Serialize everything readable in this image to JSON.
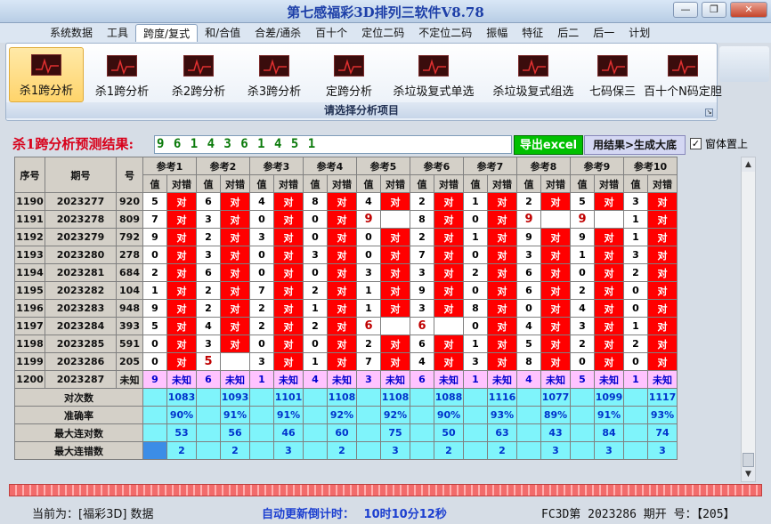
{
  "window": {
    "title": "第七感福彩3D排列三软件V8.78",
    "buttons": [
      "—",
      "❐",
      "✕"
    ]
  },
  "menu": {
    "tabs": [
      "系统数据",
      "工具",
      "跨度/复式",
      "和/合值",
      "合差/通杀",
      "百十个",
      "定位二码",
      "不定位二码",
      "振幅",
      "特征",
      "后二",
      "后一",
      "计划"
    ],
    "active_index": 2
  },
  "ribbon": {
    "buttons": [
      "杀1跨分析",
      "杀1跨分析",
      "杀2跨分析",
      "杀3跨分析",
      "定跨分析",
      "杀垃圾复式单选",
      "杀垃圾复式组选",
      "七码保三",
      "百十个N码定胆"
    ],
    "selected_index": 0,
    "caption": "请选择分析项目",
    "icon": "trend-chart-icon"
  },
  "result": {
    "label": "杀1跨分析预测结果:",
    "value": "9 6 1 4 3 6 1 4 5 1",
    "excel_button": "导出excel",
    "generate_button": "用结果>生成大底",
    "topmost_label": "窗体置上",
    "topmost_checked": true
  },
  "table": {
    "headers": {
      "seq": "序号",
      "period": "期号",
      "number": "号",
      "value": "值",
      "check": "对错"
    },
    "refs": [
      "参考1",
      "参考2",
      "参考3",
      "参考4",
      "参考5",
      "参考6",
      "参考7",
      "参考8",
      "参考9",
      "参考10"
    ],
    "rows": [
      {
        "seq": "1190",
        "period": "2023277",
        "num": "920",
        "cells": [
          [
            "5",
            "对"
          ],
          [
            "6",
            "对"
          ],
          [
            "4",
            "对"
          ],
          [
            "8",
            "对"
          ],
          [
            "4",
            "对"
          ],
          [
            "2",
            "对"
          ],
          [
            "1",
            "对"
          ],
          [
            "2",
            "对"
          ],
          [
            "5",
            "对"
          ],
          [
            "3",
            "对"
          ]
        ],
        "hl": []
      },
      {
        "seq": "1191",
        "period": "2023278",
        "num": "809",
        "cells": [
          [
            "7",
            "对"
          ],
          [
            "3",
            "对"
          ],
          [
            "0",
            "对"
          ],
          [
            "0",
            "对"
          ],
          [
            "9",
            ""
          ],
          [
            "8",
            "对"
          ],
          [
            "0",
            "对"
          ],
          [
            "9",
            ""
          ],
          [
            "9",
            ""
          ],
          [
            "1",
            "对"
          ]
        ],
        "hl": [
          4,
          7,
          8
        ]
      },
      {
        "seq": "1192",
        "period": "2023279",
        "num": "792",
        "cells": [
          [
            "9",
            "对"
          ],
          [
            "2",
            "对"
          ],
          [
            "3",
            "对"
          ],
          [
            "0",
            "对"
          ],
          [
            "0",
            "对"
          ],
          [
            "2",
            "对"
          ],
          [
            "1",
            "对"
          ],
          [
            "9",
            "对"
          ],
          [
            "9",
            "对"
          ],
          [
            "1",
            "对"
          ]
        ],
        "hl": []
      },
      {
        "seq": "1193",
        "period": "2023280",
        "num": "278",
        "cells": [
          [
            "0",
            "对"
          ],
          [
            "3",
            "对"
          ],
          [
            "0",
            "对"
          ],
          [
            "3",
            "对"
          ],
          [
            "0",
            "对"
          ],
          [
            "7",
            "对"
          ],
          [
            "0",
            "对"
          ],
          [
            "3",
            "对"
          ],
          [
            "1",
            "对"
          ],
          [
            "3",
            "对"
          ]
        ],
        "hl": []
      },
      {
        "seq": "1194",
        "period": "2023281",
        "num": "684",
        "cells": [
          [
            "2",
            "对"
          ],
          [
            "6",
            "对"
          ],
          [
            "0",
            "对"
          ],
          [
            "0",
            "对"
          ],
          [
            "3",
            "对"
          ],
          [
            "3",
            "对"
          ],
          [
            "2",
            "对"
          ],
          [
            "6",
            "对"
          ],
          [
            "0",
            "对"
          ],
          [
            "2",
            "对"
          ]
        ],
        "hl": []
      },
      {
        "seq": "1195",
        "period": "2023282",
        "num": "104",
        "cells": [
          [
            "1",
            "对"
          ],
          [
            "2",
            "对"
          ],
          [
            "7",
            "对"
          ],
          [
            "2",
            "对"
          ],
          [
            "1",
            "对"
          ],
          [
            "9",
            "对"
          ],
          [
            "0",
            "对"
          ],
          [
            "6",
            "对"
          ],
          [
            "2",
            "对"
          ],
          [
            "0",
            "对"
          ]
        ],
        "hl": []
      },
      {
        "seq": "1196",
        "period": "2023283",
        "num": "948",
        "cells": [
          [
            "9",
            "对"
          ],
          [
            "2",
            "对"
          ],
          [
            "2",
            "对"
          ],
          [
            "1",
            "对"
          ],
          [
            "1",
            "对"
          ],
          [
            "3",
            "对"
          ],
          [
            "8",
            "对"
          ],
          [
            "0",
            "对"
          ],
          [
            "4",
            "对"
          ],
          [
            "0",
            "对"
          ]
        ],
        "hl": []
      },
      {
        "seq": "1197",
        "period": "2023284",
        "num": "393",
        "cells": [
          [
            "5",
            "对"
          ],
          [
            "4",
            "对"
          ],
          [
            "2",
            "对"
          ],
          [
            "2",
            "对"
          ],
          [
            "6",
            ""
          ],
          [
            "6",
            ""
          ],
          [
            "0",
            "对"
          ],
          [
            "4",
            "对"
          ],
          [
            "3",
            "对"
          ],
          [
            "1",
            "对"
          ]
        ],
        "hl": [
          4,
          5
        ]
      },
      {
        "seq": "1198",
        "period": "2023285",
        "num": "591",
        "cells": [
          [
            "0",
            "对"
          ],
          [
            "3",
            "对"
          ],
          [
            "0",
            "对"
          ],
          [
            "0",
            "对"
          ],
          [
            "2",
            "对"
          ],
          [
            "6",
            "对"
          ],
          [
            "1",
            "对"
          ],
          [
            "5",
            "对"
          ],
          [
            "2",
            "对"
          ],
          [
            "2",
            "对"
          ]
        ],
        "hl": []
      },
      {
        "seq": "1199",
        "period": "2023286",
        "num": "205",
        "cells": [
          [
            "0",
            "对"
          ],
          [
            "5",
            ""
          ],
          [
            "3",
            "对"
          ],
          [
            "1",
            "对"
          ],
          [
            "7",
            "对"
          ],
          [
            "4",
            "对"
          ],
          [
            "3",
            "对"
          ],
          [
            "8",
            "对"
          ],
          [
            "0",
            "对"
          ],
          [
            "0",
            "对"
          ]
        ],
        "hl": [
          1
        ]
      },
      {
        "seq": "1200",
        "period": "2023287",
        "num": "未知",
        "cells": [
          [
            "9",
            "未知"
          ],
          [
            "6",
            "未知"
          ],
          [
            "1",
            "未知"
          ],
          [
            "4",
            "未知"
          ],
          [
            "3",
            "未知"
          ],
          [
            "6",
            "未知"
          ],
          [
            "1",
            "未知"
          ],
          [
            "4",
            "未知"
          ],
          [
            "5",
            "未知"
          ],
          [
            "1",
            "未知"
          ]
        ],
        "hl": [],
        "pending": true
      }
    ],
    "stats": [
      {
        "label": "对次数",
        "values": [
          "1083",
          "1093",
          "1101",
          "1108",
          "1108",
          "1088",
          "1116",
          "1077",
          "1099",
          "1117"
        ]
      },
      {
        "label": "准确率",
        "values": [
          "90%",
          "91%",
          "91%",
          "92%",
          "92%",
          "90%",
          "93%",
          "89%",
          "91%",
          "93%"
        ]
      },
      {
        "label": "最大连对数",
        "values": [
          "53",
          "56",
          "46",
          "60",
          "75",
          "50",
          "63",
          "43",
          "84",
          "74"
        ]
      },
      {
        "label": "最大连错数",
        "values": [
          "2",
          "2",
          "3",
          "2",
          "3",
          "2",
          "2",
          "3",
          "3",
          "3"
        ]
      }
    ]
  },
  "status": {
    "current": "当前为：[福彩3D] 数据",
    "countdown_label": "自动更新倒计时：",
    "countdown_value": "10时10分12秒",
    "period_info": "FC3D第 2023286 期开  号：【205】"
  },
  "colors": {
    "hit": "#ff0000",
    "pending": "#ffc3ff",
    "stat": "#7ff4fb",
    "accent_red": "#d8001a",
    "excel": "#00c000"
  }
}
